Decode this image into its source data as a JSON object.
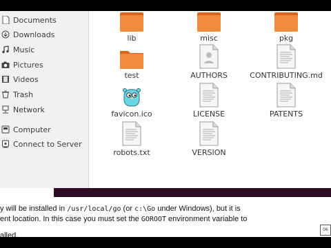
{
  "sidebar": {
    "items": [
      {
        "label": "Documents",
        "icon": "document-icon"
      },
      {
        "label": "Downloads",
        "icon": "download-icon"
      },
      {
        "label": "Music",
        "icon": "music-icon"
      },
      {
        "label": "Pictures",
        "icon": "camera-icon"
      },
      {
        "label": "Videos",
        "icon": "video-icon"
      },
      {
        "label": "Trash",
        "icon": "trash-icon"
      },
      {
        "label": "Network",
        "icon": "network-icon"
      },
      {
        "label": "Computer",
        "icon": "computer-icon"
      },
      {
        "label": "Connect to Server",
        "icon": "server-icon"
      }
    ]
  },
  "files": [
    {
      "name": "lib",
      "type": "folder"
    },
    {
      "name": "misc",
      "type": "folder"
    },
    {
      "name": "pkg",
      "type": "folder"
    },
    {
      "name": "test",
      "type": "folder"
    },
    {
      "name": "AUTHORS",
      "type": "text-person"
    },
    {
      "name": "CONTRIBUTING.md",
      "type": "text"
    },
    {
      "name": "favicon.ico",
      "type": "gopher"
    },
    {
      "name": "LICENSE",
      "type": "text"
    },
    {
      "name": "PATENTS",
      "type": "text"
    },
    {
      "name": "robots.txt",
      "type": "text"
    },
    {
      "name": "VERSION",
      "type": "text"
    }
  ],
  "doc": {
    "line1_a": "y will be installed in ",
    "line1_code1": "/usr/local/go",
    "line1_b": " (or ",
    "line1_code2": "c:\\Go",
    "line1_c": " under Windows), but it is",
    "line2_a": "ent location. In this case you must set the ",
    "line2_code": "GOROOT",
    "line2_b": " environment variable to",
    "line3": "alled."
  },
  "corner_badge": "06",
  "colors": {
    "folder_orange": "#f08a3c",
    "folder_orange_dark": "#d9651f",
    "sidebar_bg": "#f2f1f0",
    "strip_dark": "#2d0b22",
    "gopher_blue": "#6ad7e5"
  }
}
